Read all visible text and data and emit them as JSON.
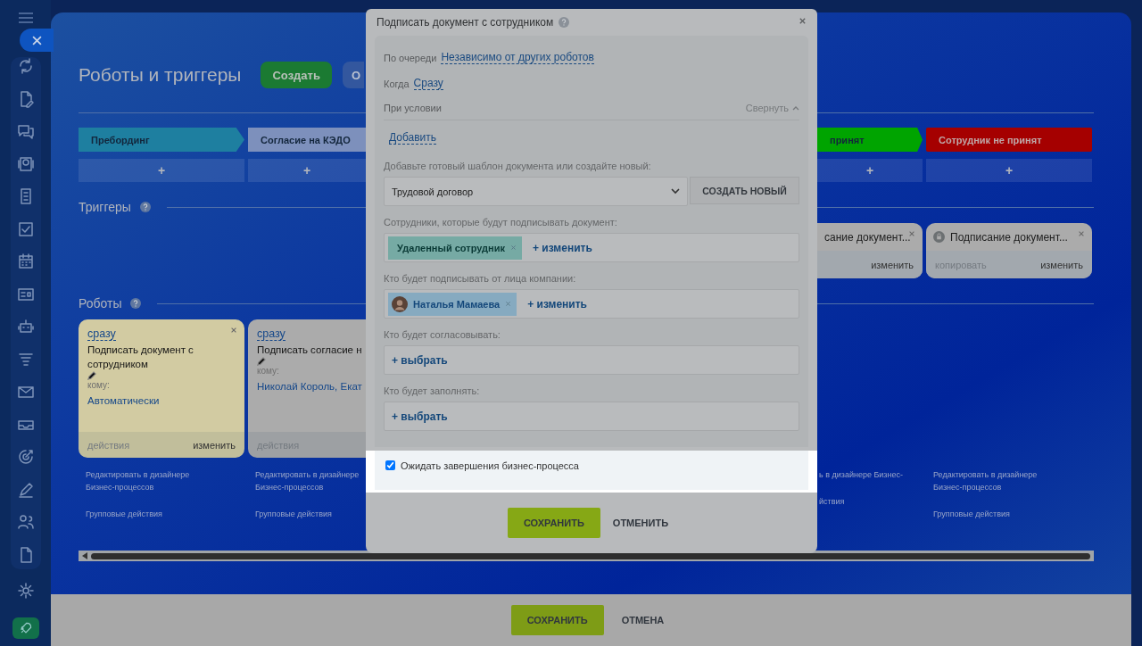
{
  "page": {
    "title": "Роботы и триггеры",
    "create_button": "Создать",
    "other_button": "О"
  },
  "stages": [
    {
      "label": "Пребординг",
      "color": "#1e7fa0",
      "add": "+"
    },
    {
      "label": "Согласие на КЭДО",
      "color": "#7d90bc",
      "add": "+"
    },
    {
      "label": "принят",
      "color": "#00a400",
      "add": "+"
    },
    {
      "label": "Сотрудник не принят",
      "color": "#a50000",
      "add": "+"
    }
  ],
  "triggers": {
    "heading": "Триггеры",
    "cards": [
      {
        "title": "сание документ...",
        "edit": "изменить"
      },
      {
        "title": "Подписание документ...",
        "copy": "копировать",
        "edit": "изменить"
      }
    ]
  },
  "robots": {
    "heading": "Роботы",
    "cards": [
      {
        "timing": "сразу",
        "title": "Подписать документ с сотрудником",
        "to_label": "кому:",
        "to": "Автоматически",
        "actions": "действия",
        "edit": "изменить",
        "color": "#d2cba2"
      },
      {
        "timing": "сразу",
        "title": "Подписать согласие н",
        "to_label": "кому:",
        "to": "Николай Король, Екат",
        "actions": "действия",
        "color": "#ababab"
      }
    ],
    "links": [
      {
        "designer": "Редактировать в дизайнере Бизнес-процессов",
        "group": "Групповые действия"
      },
      {
        "designer": "Редактировать в дизайнере Бизнес-процессов",
        "group": "Групповые действия"
      },
      {
        "designer": "ь в дизайнере Бизнес-",
        "group": "йствия"
      },
      {
        "designer": "Редактировать в дизайнере Бизнес-процессов",
        "group": "Групповые действия"
      }
    ]
  },
  "modal": {
    "title": "Подписать документ с сотрудником",
    "order_label": "По очереди",
    "order_value": "Независимо от других роботов",
    "when_label": "Когда",
    "when_value": "Сразу",
    "condition_label": "При условии",
    "collapse": "Свернуть",
    "add_condition": "Добавить",
    "template_label": "Добавьте готовый шаблон документа или создайте новый:",
    "template_value": "Трудовой договор",
    "create_new": "СОЗДАТЬ НОВЫЙ",
    "pickers": [
      {
        "label": "Сотрудники, которые будут подписывать документ:",
        "tags": [
          {
            "name": "Удаленный сотрудник",
            "kind": "group"
          }
        ],
        "action": "+ изменить"
      },
      {
        "label": "Кто будет подписывать от лица компании:",
        "tags": [
          {
            "name": "Наталья Мамаева",
            "kind": "user"
          }
        ],
        "action": "+ изменить"
      },
      {
        "label": "Кто будет согласовывать:",
        "action": "+ выбрать"
      },
      {
        "label": "Кто будет заполнять:",
        "action": "+ выбрать"
      }
    ],
    "wait": {
      "label": "Ожидать завершения бизнес-процесса",
      "checked": true
    },
    "save": "СОХРАНИТЬ",
    "cancel": "ОТМЕНИТЬ"
  },
  "footer": {
    "save": "СОХРАНИТЬ",
    "cancel": "ОТМЕНА"
  }
}
